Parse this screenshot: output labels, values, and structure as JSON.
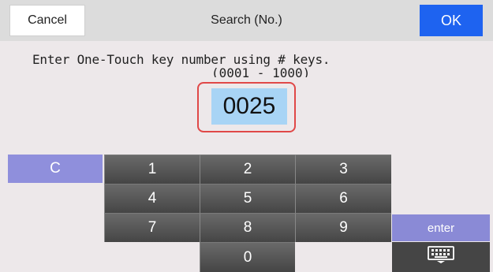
{
  "header": {
    "cancel_label": "Cancel",
    "title": "Search (No.)",
    "ok_label": "OK"
  },
  "prompt": {
    "instruction": "Enter One-Touch key number using # keys.",
    "range": "(0001 - 1000)"
  },
  "input": {
    "value": "0025"
  },
  "keypad": {
    "clear": "C",
    "k1": "1",
    "k2": "2",
    "k3": "3",
    "k4": "4",
    "k5": "5",
    "k6": "6",
    "k7": "7",
    "k8": "8",
    "k9": "9",
    "k0": "0",
    "enter": "enter"
  },
  "colors": {
    "ok_button": "#1e63f0",
    "input_background": "#a8d4f5",
    "highlight_border": "#e04848",
    "purple_key": "#8f8fdc",
    "digit_key": "#555555"
  },
  "icons": {
    "keyboard": "keyboard-icon"
  }
}
